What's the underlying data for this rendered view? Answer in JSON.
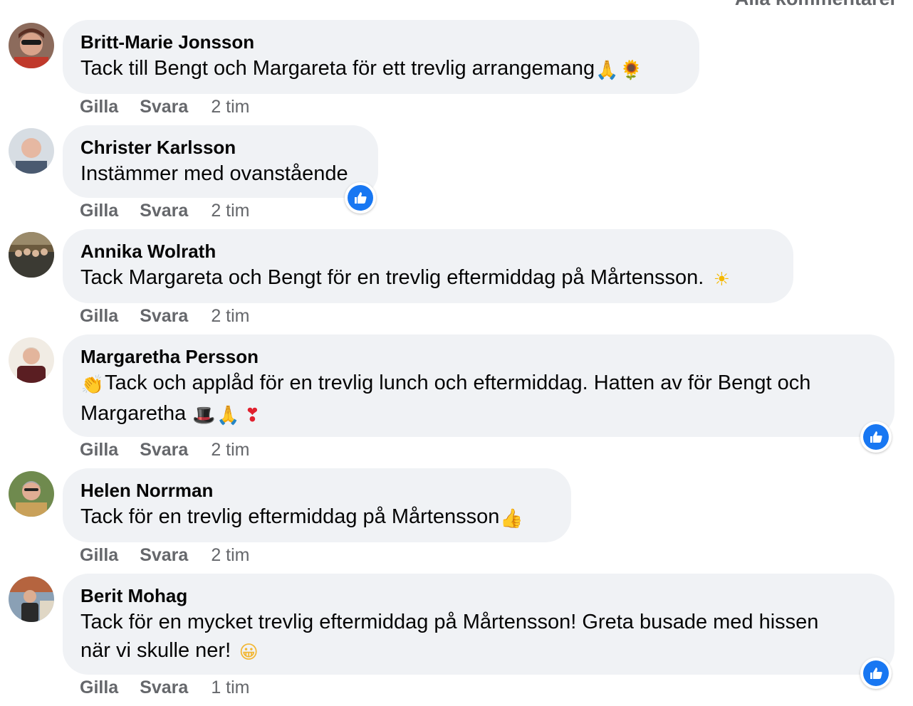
{
  "header": {
    "all_comments_label": "Alla kommentarer"
  },
  "actions": {
    "like_label": "Gilla",
    "reply_label": "Svara"
  },
  "colors": {
    "bubble": "#f0f2f5",
    "meta_text": "#65676b",
    "reaction_blue": "#1877f2"
  },
  "comments": [
    {
      "author": "Britt-Marie Jonsson",
      "lines": [
        "Tack till Bengt och Margareta för ett trevlig arrangemang"
      ],
      "emojis": [
        "🙏",
        "🌻"
      ],
      "time": "2 tim",
      "reaction": null
    },
    {
      "author": "Christer Karlsson",
      "lines": [
        "Instämmer med ovanstående"
      ],
      "emojis": [],
      "time": "2 tim",
      "reaction": "like-icon"
    },
    {
      "author": "Annika Wolrath",
      "lines": [
        "Tack Margareta och Bengt för en trevlig eftermiddag på Mårtensson."
      ],
      "emojis": [
        "☀"
      ],
      "time": "2 tim",
      "reaction": null
    },
    {
      "author": "Margaretha Persson",
      "lines": [
        "Tack och applåd för en trevlig lunch och eftermiddag. Hatten av för Bengt och",
        "Margaretha"
      ],
      "emojis": [
        "👏",
        "🎩",
        "🙏",
        "❣"
      ],
      "time": "2 tim",
      "reaction": "like-icon"
    },
    {
      "author": "Helen Norrman",
      "lines": [
        "Tack för en trevlig eftermiddag på Mårtensson"
      ],
      "emojis": [
        "👍"
      ],
      "time": "2 tim",
      "reaction": null
    },
    {
      "author": "Berit Mohag",
      "lines": [
        "Tack för en mycket trevlig eftermiddag på Mårtensson! Greta busade med hissen",
        "när vi skulle ner!"
      ],
      "emojis": [
        "😀"
      ],
      "time": "1 tim",
      "reaction": "like-icon"
    }
  ]
}
